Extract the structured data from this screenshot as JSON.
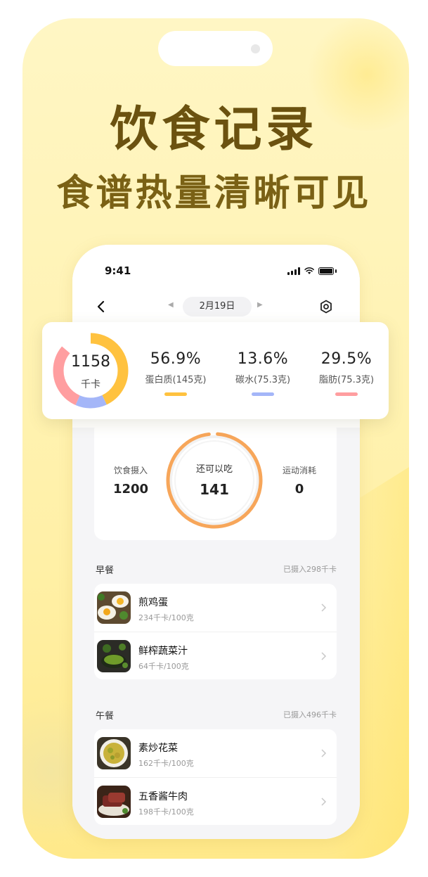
{
  "promo": {
    "headline": "饮食记录",
    "subline": "食谱热量清晰可见"
  },
  "status_bar": {
    "time": "9:41"
  },
  "nav": {
    "date": "2月19日",
    "prev_icon": "caret-left-icon",
    "next_icon": "caret-right-icon",
    "back_icon": "chevron-left-icon",
    "settings_icon": "hexagon-settings-icon"
  },
  "summary": {
    "calories": "1158",
    "calories_unit": "千卡",
    "macros": [
      {
        "percent": "56.9%",
        "label": "蛋白质(145克)",
        "color": "#ffc23f",
        "fraction": 0.569
      },
      {
        "percent": "13.6%",
        "label": "碳水(75.3克)",
        "color": "#a4b6f8",
        "fraction": 0.136
      },
      {
        "percent": "29.5%",
        "label": "脂肪(75.3克)",
        "color": "#ff9ea0",
        "fraction": 0.295
      }
    ]
  },
  "intake": {
    "food_label": "饮食摄入",
    "food_value": "1200",
    "remaining_label": "还可以吃",
    "remaining_value": "141",
    "exercise_label": "运动消耗",
    "exercise_value": "0",
    "ring_color": "#f7a65a"
  },
  "meals": [
    {
      "title": "早餐",
      "total": "已摄入298千卡",
      "items": [
        {
          "name": "煎鸡蛋",
          "kcal": "234千卡/100克"
        },
        {
          "name": "鲜榨蔬菜汁",
          "kcal": "64千卡/100克"
        }
      ]
    },
    {
      "title": "午餐",
      "total": "已摄入496千卡",
      "items": [
        {
          "name": "素炒花菜",
          "kcal": "162千卡/100克"
        },
        {
          "name": "五香酱牛肉",
          "kcal": "198千卡/100克"
        }
      ]
    }
  ]
}
